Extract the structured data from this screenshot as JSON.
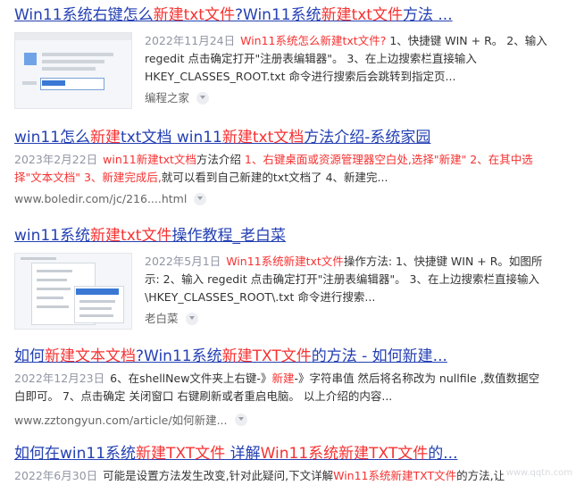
{
  "results": [
    {
      "title_parts": [
        "Win11系统右键怎么",
        "新建txt文件",
        "?Win11系统",
        "新建txt文件",
        "方法 ..."
      ],
      "date": "2022年11月24日",
      "snippet": {
        "a": "Win11系统怎么新建txt文件?",
        "b": " 1、快捷键 WIN + R。 2、输入 regedit 点击确定打开\"注册表编辑器\"。 3、在上边搜索栏直接输入 HKEY_CLASSES_ROOT.txt 命令进行搜索后会跳转到指定页..."
      },
      "source": "编程之家",
      "thumb_icon": "run-dialog-screenshot"
    },
    {
      "title_parts": [
        "win11怎么",
        "新建",
        "txt文档 win11",
        "新建txt文档",
        "方法介绍-系统家园"
      ],
      "date": "2023年2月22日",
      "snippet": {
        "a": "win11新建txt文档",
        "b": "方法介绍 ",
        "c": "1、右键桌面或资源管理器空白处,选择\"新建\" 2、在其中选择\"文本文档\" 3、新建完成后,",
        "d": "就可以看到自己新建的txt文档了 4、新建完..."
      },
      "source": "www.boledir.com/jc/216....html"
    },
    {
      "title_parts": [
        "win11系统",
        "新建txt文件",
        "操作教程_老白菜"
      ],
      "date": "2022年5月1日",
      "snippet": {
        "a": "Win11系统",
        "b": "新建txt文件",
        "c": "操作方法: 1、快捷键 WIN + R。如图所示: 2、输入 regedit 点击确定打开\"注册表编辑器\"。 3、在上边搜索栏直接输入 \\HKEY_CLASSES_ROOT\\.txt 命令进行搜索..."
      },
      "source": "老白菜",
      "thumb_icon": "context-menu-screenshot"
    },
    {
      "title_parts": [
        "如何",
        "新建文本文档",
        "?Win11系统",
        "新建TXT文件",
        "的方法 - 如何新建..."
      ],
      "date": "2022年12月23日",
      "snippet": {
        "a": "6、在shellNew文件夹上右键-》",
        "b": "新建",
        "c": "-》字符串值 然后将名称改为 nullfile ,数值数据空白即可。 7、点击确定 关闭窗口 右键刷新或者重启电脑。 以上介绍的内容..."
      },
      "source": "www.zztongyun.com/article/如何新建..."
    },
    {
      "title_parts": [
        "如何在win11系统",
        "新建TXT文件",
        " 详解",
        "Win11系统",
        "新建TXT文件",
        "的..."
      ],
      "date": "2022年6月30日",
      "snippet": {
        "a": "可能是设置方法发生改变,针对此疑问,下文详解",
        "b": "Win11系统新建TXT文件",
        "c": "的方法,让"
      }
    }
  ],
  "watermark": "www.qqtn.com"
}
